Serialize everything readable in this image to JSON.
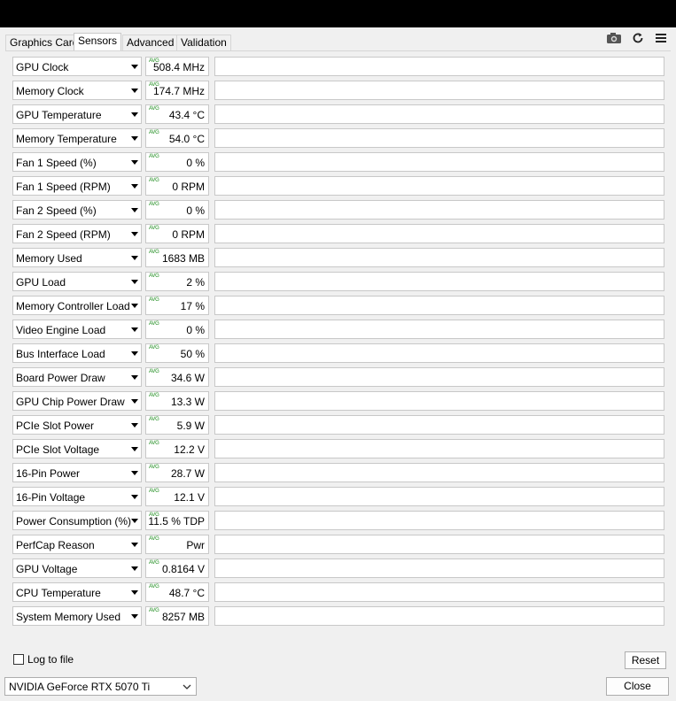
{
  "tabs": [
    {
      "label": "Graphics Card",
      "active": false
    },
    {
      "label": "Sensors",
      "active": true
    },
    {
      "label": "Advanced",
      "active": false
    },
    {
      "label": "Validation",
      "active": false
    }
  ],
  "toolbar": {
    "icons": [
      "camera-icon",
      "refresh-icon",
      "menu-icon"
    ]
  },
  "avg_label": "AVG",
  "colors": {
    "graph_fill": "#ff0000",
    "perfcap_green": "#00a000",
    "perfcap_blue": "#3399ff"
  },
  "sensors": [
    {
      "name": "GPU Clock",
      "value": "508.4 MHz"
    },
    {
      "name": "Memory Clock",
      "value": "174.7 MHz"
    },
    {
      "name": "GPU Temperature",
      "value": "43.4 °C"
    },
    {
      "name": "Memory Temperature",
      "value": "54.0 °C"
    },
    {
      "name": "Fan 1 Speed (%)",
      "value": "0 %"
    },
    {
      "name": "Fan 1 Speed (RPM)",
      "value": "0 RPM"
    },
    {
      "name": "Fan 2 Speed (%)",
      "value": "0 %"
    },
    {
      "name": "Fan 2 Speed (RPM)",
      "value": "0 RPM"
    },
    {
      "name": "Memory Used",
      "value": "1683 MB"
    },
    {
      "name": "GPU Load",
      "value": "2 %"
    },
    {
      "name": "Memory Controller Load",
      "value": "17 %"
    },
    {
      "name": "Video Engine Load",
      "value": "0 %"
    },
    {
      "name": "Bus Interface Load",
      "value": "50 %"
    },
    {
      "name": "Board Power Draw",
      "value": "34.6 W"
    },
    {
      "name": "GPU Chip Power Draw",
      "value": "13.3 W"
    },
    {
      "name": "PCIe Slot Power",
      "value": "5.9 W"
    },
    {
      "name": "PCIe Slot Voltage",
      "value": "12.2 V"
    },
    {
      "name": "16-Pin Power",
      "value": "28.7 W"
    },
    {
      "name": "16-Pin Voltage",
      "value": "12.1 V"
    },
    {
      "name": "Power Consumption (%)",
      "value": "11.5 % TDP"
    },
    {
      "name": "PerfCap Reason",
      "value": "Pwr"
    },
    {
      "name": "GPU Voltage",
      "value": "0.8164 V"
    },
    {
      "name": "CPU Temperature",
      "value": "48.7 °C"
    },
    {
      "name": "System Memory Used",
      "value": "8257 MB"
    }
  ],
  "footer": {
    "log_label": "Log to file",
    "log_checked": false,
    "reset_label": "Reset",
    "gpu_selected": "NVIDIA GeForce RTX 5070 Ti",
    "close_label": "Close"
  }
}
